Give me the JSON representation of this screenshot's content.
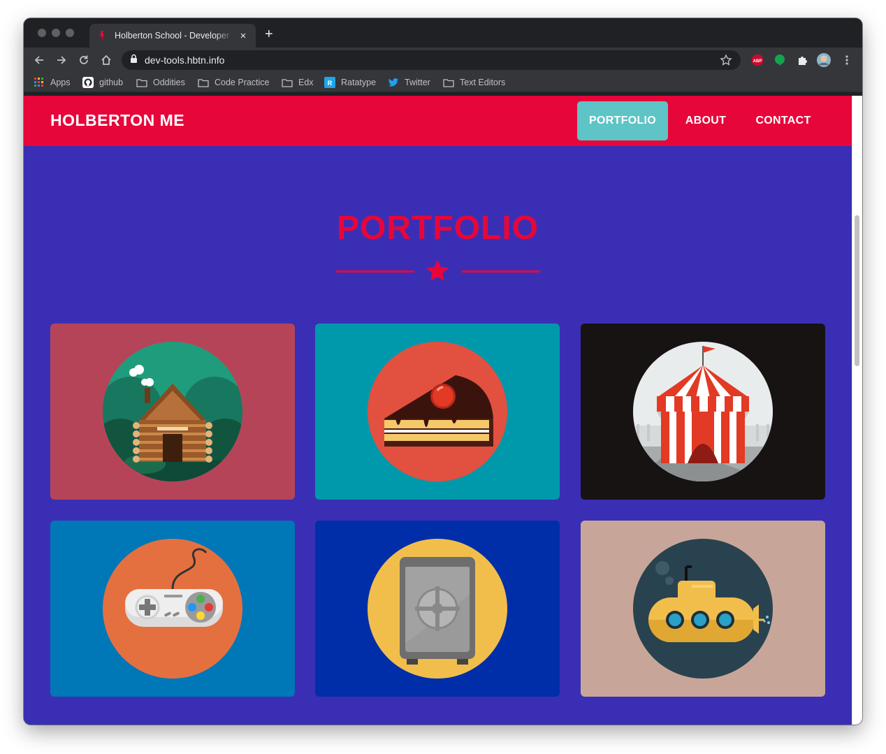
{
  "browser": {
    "tab_title": "Holberton School - Developer Tools",
    "new_tab_label": "+",
    "close_tab_label": "×",
    "url": "dev-tools.hbtn.info",
    "bookmarks": [
      {
        "label": "Apps",
        "icon": "apps-grid-icon"
      },
      {
        "label": "github",
        "icon": "github-icon"
      },
      {
        "label": "Oddities",
        "icon": "folder-icon"
      },
      {
        "label": "Code Practice",
        "icon": "folder-icon"
      },
      {
        "label": "Edx",
        "icon": "folder-icon"
      },
      {
        "label": "Ratatype",
        "icon": "ratatype-icon"
      },
      {
        "label": "Twitter",
        "icon": "twitter-icon"
      },
      {
        "label": "Text Editors",
        "icon": "folder-icon"
      }
    ],
    "extensions": [
      {
        "name": "adblock-plus-icon",
        "label": "ABP"
      },
      {
        "name": "evernote-icon"
      },
      {
        "name": "puzzle-extensions-icon"
      },
      {
        "name": "profile-avatar"
      },
      {
        "name": "kebab-menu-icon"
      }
    ]
  },
  "site": {
    "brand": "HOLBERTON ME",
    "nav": [
      {
        "label": "PORTFOLIO",
        "active": true
      },
      {
        "label": "ABOUT",
        "active": false
      },
      {
        "label": "CONTACT",
        "active": false
      }
    ],
    "section_title": "PORTFOLIO",
    "portfolio": [
      {
        "name": "log-cabin",
        "bg": "#b64458",
        "circle": "#1f9c7c"
      },
      {
        "name": "cake-slice",
        "bg": "#0099ab",
        "circle": "#e25040"
      },
      {
        "name": "circus-tent",
        "bg": "#161312",
        "circle": "#e8ecec"
      },
      {
        "name": "game-controller",
        "bg": "#0077b7",
        "circle": "#e5703f"
      },
      {
        "name": "safe",
        "bg": "#002ea8",
        "circle": "#f2be4b"
      },
      {
        "name": "submarine",
        "bg": "#c7a699",
        "circle": "#29424f"
      }
    ]
  },
  "colors": {
    "brand_red": "#e7063a",
    "page_bg": "#3a2fb4",
    "active_nav": "#5ec4c6"
  }
}
